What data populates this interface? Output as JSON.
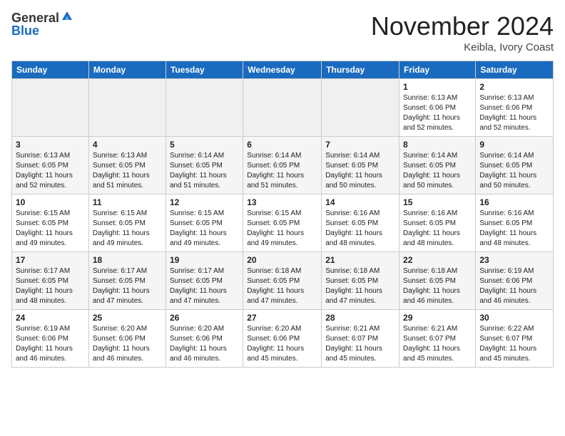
{
  "logo": {
    "general": "General",
    "blue": "Blue"
  },
  "title": "November 2024",
  "location": "Keibla, Ivory Coast",
  "weekdays": [
    "Sunday",
    "Monday",
    "Tuesday",
    "Wednesday",
    "Thursday",
    "Friday",
    "Saturday"
  ],
  "weeks": [
    [
      {
        "day": "",
        "info": ""
      },
      {
        "day": "",
        "info": ""
      },
      {
        "day": "",
        "info": ""
      },
      {
        "day": "",
        "info": ""
      },
      {
        "day": "",
        "info": ""
      },
      {
        "day": "1",
        "info": "Sunrise: 6:13 AM\nSunset: 6:06 PM\nDaylight: 11 hours\nand 52 minutes."
      },
      {
        "day": "2",
        "info": "Sunrise: 6:13 AM\nSunset: 6:06 PM\nDaylight: 11 hours\nand 52 minutes."
      }
    ],
    [
      {
        "day": "3",
        "info": "Sunrise: 6:13 AM\nSunset: 6:05 PM\nDaylight: 11 hours\nand 52 minutes."
      },
      {
        "day": "4",
        "info": "Sunrise: 6:13 AM\nSunset: 6:05 PM\nDaylight: 11 hours\nand 51 minutes."
      },
      {
        "day": "5",
        "info": "Sunrise: 6:14 AM\nSunset: 6:05 PM\nDaylight: 11 hours\nand 51 minutes."
      },
      {
        "day": "6",
        "info": "Sunrise: 6:14 AM\nSunset: 6:05 PM\nDaylight: 11 hours\nand 51 minutes."
      },
      {
        "day": "7",
        "info": "Sunrise: 6:14 AM\nSunset: 6:05 PM\nDaylight: 11 hours\nand 50 minutes."
      },
      {
        "day": "8",
        "info": "Sunrise: 6:14 AM\nSunset: 6:05 PM\nDaylight: 11 hours\nand 50 minutes."
      },
      {
        "day": "9",
        "info": "Sunrise: 6:14 AM\nSunset: 6:05 PM\nDaylight: 11 hours\nand 50 minutes."
      }
    ],
    [
      {
        "day": "10",
        "info": "Sunrise: 6:15 AM\nSunset: 6:05 PM\nDaylight: 11 hours\nand 49 minutes."
      },
      {
        "day": "11",
        "info": "Sunrise: 6:15 AM\nSunset: 6:05 PM\nDaylight: 11 hours\nand 49 minutes."
      },
      {
        "day": "12",
        "info": "Sunrise: 6:15 AM\nSunset: 6:05 PM\nDaylight: 11 hours\nand 49 minutes."
      },
      {
        "day": "13",
        "info": "Sunrise: 6:15 AM\nSunset: 6:05 PM\nDaylight: 11 hours\nand 49 minutes."
      },
      {
        "day": "14",
        "info": "Sunrise: 6:16 AM\nSunset: 6:05 PM\nDaylight: 11 hours\nand 48 minutes."
      },
      {
        "day": "15",
        "info": "Sunrise: 6:16 AM\nSunset: 6:05 PM\nDaylight: 11 hours\nand 48 minutes."
      },
      {
        "day": "16",
        "info": "Sunrise: 6:16 AM\nSunset: 6:05 PM\nDaylight: 11 hours\nand 48 minutes."
      }
    ],
    [
      {
        "day": "17",
        "info": "Sunrise: 6:17 AM\nSunset: 6:05 PM\nDaylight: 11 hours\nand 48 minutes."
      },
      {
        "day": "18",
        "info": "Sunrise: 6:17 AM\nSunset: 6:05 PM\nDaylight: 11 hours\nand 47 minutes."
      },
      {
        "day": "19",
        "info": "Sunrise: 6:17 AM\nSunset: 6:05 PM\nDaylight: 11 hours\nand 47 minutes."
      },
      {
        "day": "20",
        "info": "Sunrise: 6:18 AM\nSunset: 6:05 PM\nDaylight: 11 hours\nand 47 minutes."
      },
      {
        "day": "21",
        "info": "Sunrise: 6:18 AM\nSunset: 6:05 PM\nDaylight: 11 hours\nand 47 minutes."
      },
      {
        "day": "22",
        "info": "Sunrise: 6:18 AM\nSunset: 6:05 PM\nDaylight: 11 hours\nand 46 minutes."
      },
      {
        "day": "23",
        "info": "Sunrise: 6:19 AM\nSunset: 6:06 PM\nDaylight: 11 hours\nand 46 minutes."
      }
    ],
    [
      {
        "day": "24",
        "info": "Sunrise: 6:19 AM\nSunset: 6:06 PM\nDaylight: 11 hours\nand 46 minutes."
      },
      {
        "day": "25",
        "info": "Sunrise: 6:20 AM\nSunset: 6:06 PM\nDaylight: 11 hours\nand 46 minutes."
      },
      {
        "day": "26",
        "info": "Sunrise: 6:20 AM\nSunset: 6:06 PM\nDaylight: 11 hours\nand 46 minutes."
      },
      {
        "day": "27",
        "info": "Sunrise: 6:20 AM\nSunset: 6:06 PM\nDaylight: 11 hours\nand 45 minutes."
      },
      {
        "day": "28",
        "info": "Sunrise: 6:21 AM\nSunset: 6:07 PM\nDaylight: 11 hours\nand 45 minutes."
      },
      {
        "day": "29",
        "info": "Sunrise: 6:21 AM\nSunset: 6:07 PM\nDaylight: 11 hours\nand 45 minutes."
      },
      {
        "day": "30",
        "info": "Sunrise: 6:22 AM\nSunset: 6:07 PM\nDaylight: 11 hours\nand 45 minutes."
      }
    ]
  ]
}
